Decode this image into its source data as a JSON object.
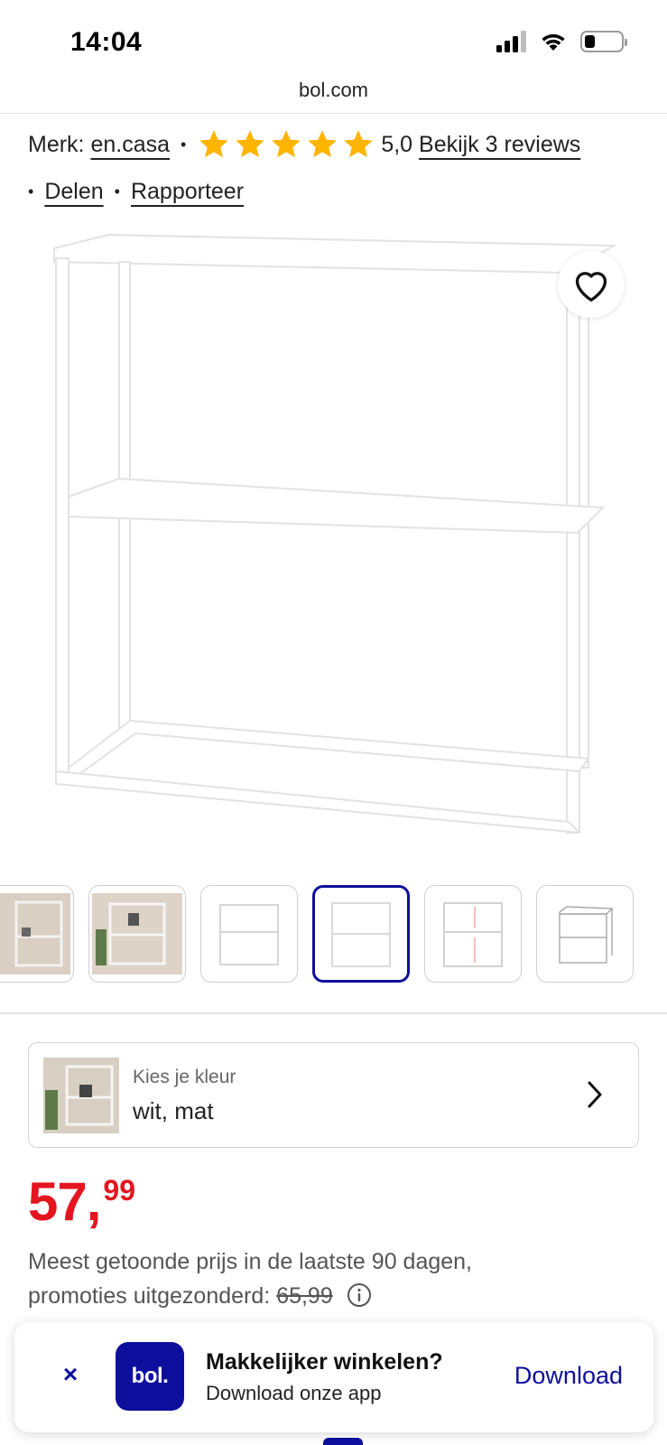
{
  "status_bar": {
    "time": "14:04"
  },
  "browser": {
    "url": "bol.com"
  },
  "product_meta": {
    "brand_label": "Merk:",
    "brand_name": "en.casa",
    "rating_value": "5,0",
    "rating_stars": 5,
    "reviews_link": "Bekijk 3 reviews",
    "share_link": "Delen",
    "report_link": "Rapporteer"
  },
  "product_image": {
    "alt_icon": "favorite-heart-icon"
  },
  "thumbnails": {
    "count": 6,
    "active_index": 3
  },
  "color_chooser": {
    "label": "Kies je kleur",
    "value": "wit, mat"
  },
  "price": {
    "integer": "57",
    "comma": ",",
    "decimals": "99",
    "note_line1": "Meest getoonde prijs in de laatste 90 dagen,",
    "note_line2": "promoties uitgezonderd:",
    "old_price": "65,99"
  },
  "app_banner": {
    "close": "×",
    "logo_text": "bol.",
    "title": "Makkelijker winkelen?",
    "subtitle": "Download onze app",
    "download": "Download"
  },
  "colors": {
    "brand": "#0e0e9c",
    "price": "#e4151f",
    "star": "#ffb400"
  }
}
